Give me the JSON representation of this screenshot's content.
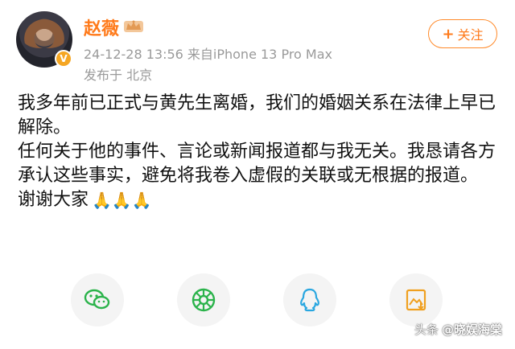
{
  "header": {
    "username": "赵薇",
    "verified_badge": "V",
    "meta": "24-12-28 13:56  来自iPhone 13 Pro Max",
    "location": "发布于 北京",
    "follow_label": "关注"
  },
  "post": {
    "para1": "我多年前已正式与黄先生离婚，我们的婚姻关系在法律上早已解除。",
    "para2": "任何关于他的事件、言论或新闻报道都与我无关。我恳请各方承认这些事实，避免将我卷入虚假的关联或无根据的报道。",
    "thanks": "谢谢大家",
    "emoji": "🙏🙏🙏"
  },
  "share": {
    "icons": [
      "wechat-icon",
      "moments-icon",
      "qq-icon",
      "save-image-icon"
    ]
  },
  "watermark": {
    "prefix": "头条",
    "handle": "@晓娱海棠"
  },
  "colors": {
    "accent": "#ff7a1a",
    "wechat": "#2bb34b",
    "qq": "#2aa7e0",
    "save": "#f0a020"
  }
}
